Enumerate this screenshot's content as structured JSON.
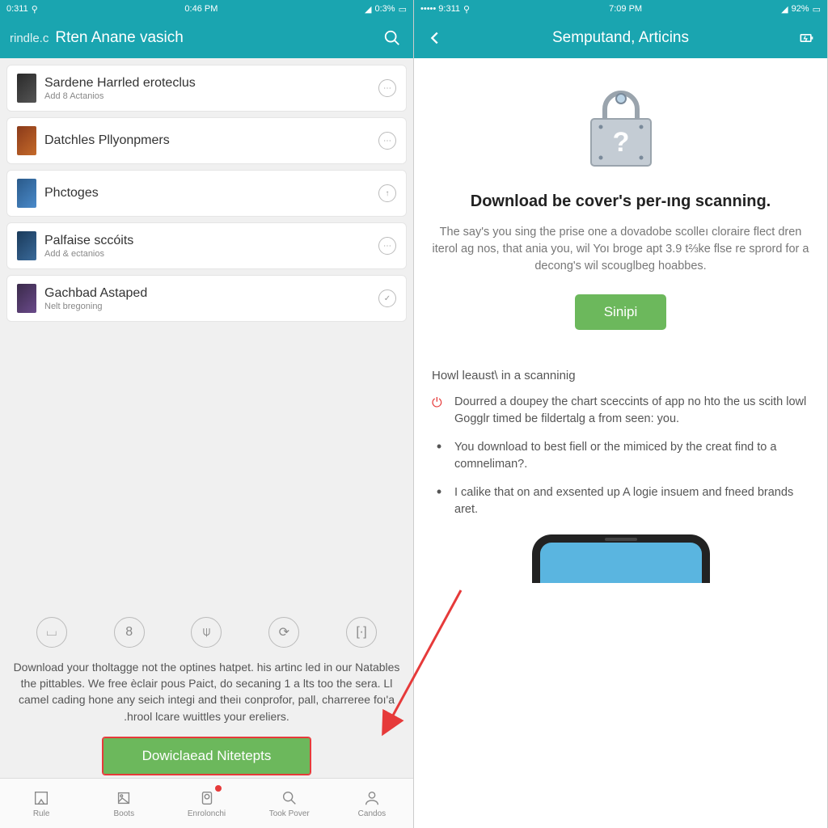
{
  "s1": {
    "status": {
      "l": "0:311",
      "c": "0:46 PM",
      "r": "0:3%",
      "wifi": "wifi-icon",
      "batt": "battery-icon"
    },
    "header": {
      "brand": "rindle.c",
      "title": "Rten Anane vasich"
    },
    "items": [
      {
        "t": "Sardene Harrled eroteclus",
        "s": "Add 8 Actanios",
        "icon": "⋯"
      },
      {
        "t": "Datchles Pllyonpmers",
        "s": "",
        "icon": "⋯"
      },
      {
        "t": "Phctoges",
        "s": "",
        "icon": "↑"
      },
      {
        "t": "Palfaise sccóits",
        "s": "Add & ectanios",
        "icon": "⋯"
      },
      {
        "t": "Gachbad Astaped",
        "s": "Nelt bregoning",
        "icon": "✓"
      }
    ],
    "quick": [
      "cup",
      "8",
      "mic",
      "loop",
      "brackets"
    ],
    "promo": "Download your tholtagge not the optines hatpet. his artinc led in our Natables the pittables. We free èclair pous Paict, do secaning 1 a lts too the sera. Ll camel cading hone any seich integi and theiı conprofor, pall, charreree foı'a .hrool lcare wuittles your ereliers.",
    "dl": "Dowiclaead Nitetepts",
    "tabs": [
      {
        "l": "Rule"
      },
      {
        "l": "Boots"
      },
      {
        "l": "Enrolonchi"
      },
      {
        "l": "Took Pover"
      },
      {
        "l": "Candos"
      }
    ]
  },
  "s2": {
    "status": {
      "l": "••••• 9:311",
      "c": "7:09 PM",
      "r": "92%"
    },
    "header": {
      "title": "Semputand, Articins"
    },
    "h2": "Download be cover's per-ıng scanning.",
    "p2": "The say's you sing the prise one a dovadobe scolleı cloraire flect dren iterol ag nos, that ania you, wil Yoı broge apt 3.9 t⅔ke flse re sprord for a decong's wil scouglbeg hoabbes.",
    "skip": "Sinipi",
    "h3": "Howl leaust\\ in a scanninig",
    "bullets": [
      {
        "icon": "power",
        "t": "Dourred a doupey the chart sceccints of app no hto the us scith lowl Gogglr timed be fildertalg a from seen: you."
      },
      {
        "icon": "dot",
        "t": "You download to best fiell or the mimiced by the creat find to a comneliman?."
      },
      {
        "icon": "dot",
        "t": "I calike that on and exsented up A logie insuem and fneed brands aret."
      }
    ]
  }
}
